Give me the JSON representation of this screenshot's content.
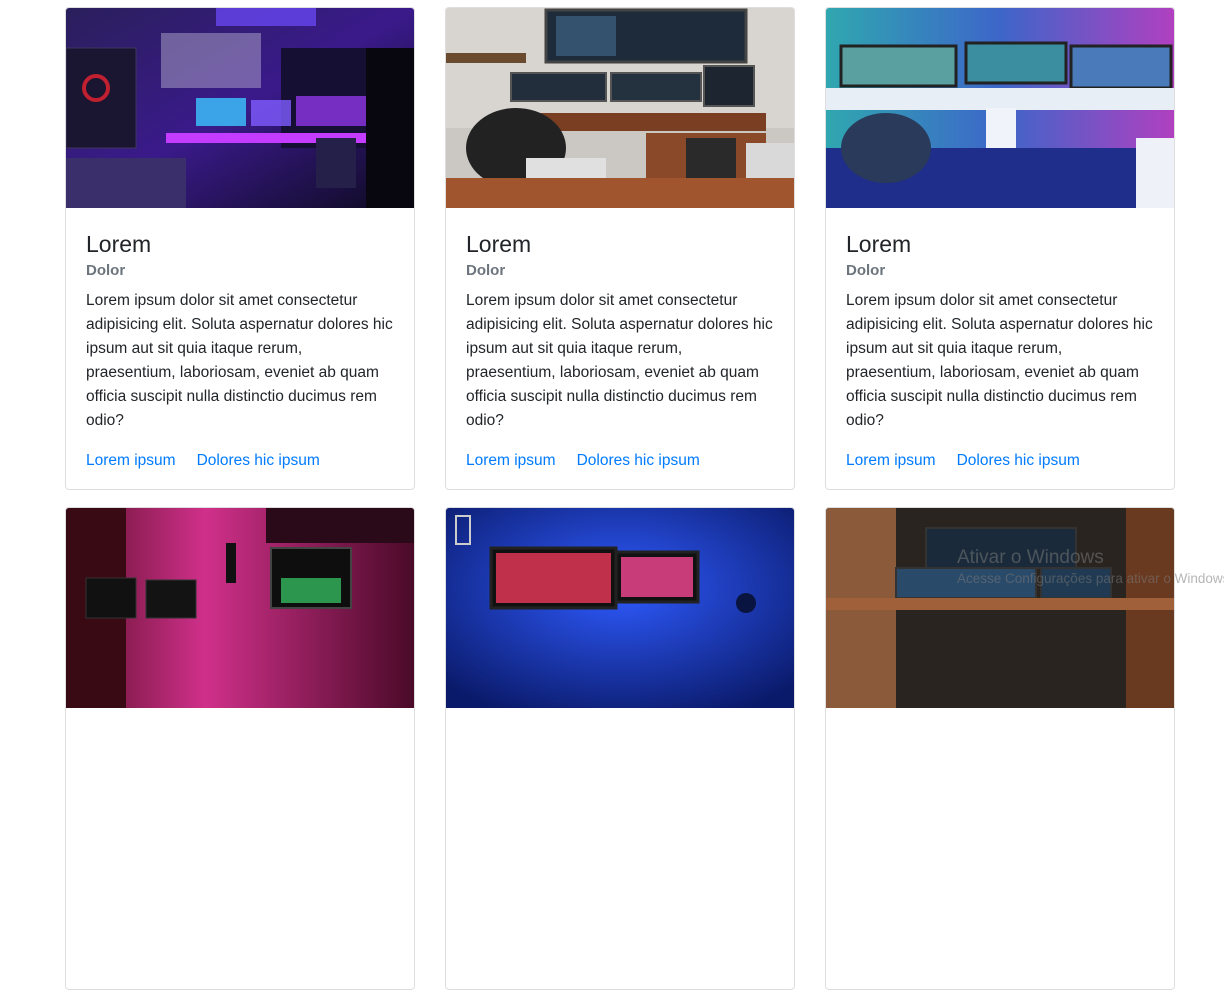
{
  "cards": [
    {
      "title": "Lorem",
      "subtitle": "Dolor",
      "text": "Lorem ipsum dolor sit amet consectetur adipisicing elit. Soluta aspernatur dolores hic ipsum aut sit quia itaque rerum, praesentium, laboriosam, eveniet ab quam officia suscipit nulla distinctio ducimus rem odio?",
      "link1": "Lorem ipsum",
      "link2": "Dolores hic ipsum",
      "image": "gaming-room-purple-neon"
    },
    {
      "title": "Lorem",
      "subtitle": "Dolor",
      "text": "Lorem ipsum dolor sit amet consectetur adipisicing elit. Soluta aspernatur dolores hic ipsum aut sit quia itaque rerum, praesentium, laboriosam, eveniet ab quam officia suscipit nulla distinctio ducimus rem odio?",
      "link1": "Lorem ipsum",
      "link2": "Dolores hic ipsum",
      "image": "wooden-desk-multi-monitor"
    },
    {
      "title": "Lorem",
      "subtitle": "Dolor",
      "text": "Lorem ipsum dolor sit amet consectetur adipisicing elit. Soluta aspernatur dolores hic ipsum aut sit quia itaque rerum, praesentium, laboriosam, eveniet ab quam officia suscipit nulla distinctio ducimus rem odio?",
      "link1": "Lorem ipsum",
      "link2": "Dolores hic ipsum",
      "image": "white-corner-desk-blue-rgb"
    },
    {
      "image": "pink-rgb-setup"
    },
    {
      "image": "blue-neon-dual-monitor"
    },
    {
      "image": "dark-desk-warm-light"
    }
  ],
  "watermark": {
    "title": "Ativar o Windows",
    "subtitle": "Acesse Configurações para ativar o Windows."
  },
  "colors": {
    "link": "#007bff",
    "title": "#212529",
    "subtitle": "#6c757d",
    "border": "rgba(0,0,0,0.13)"
  }
}
